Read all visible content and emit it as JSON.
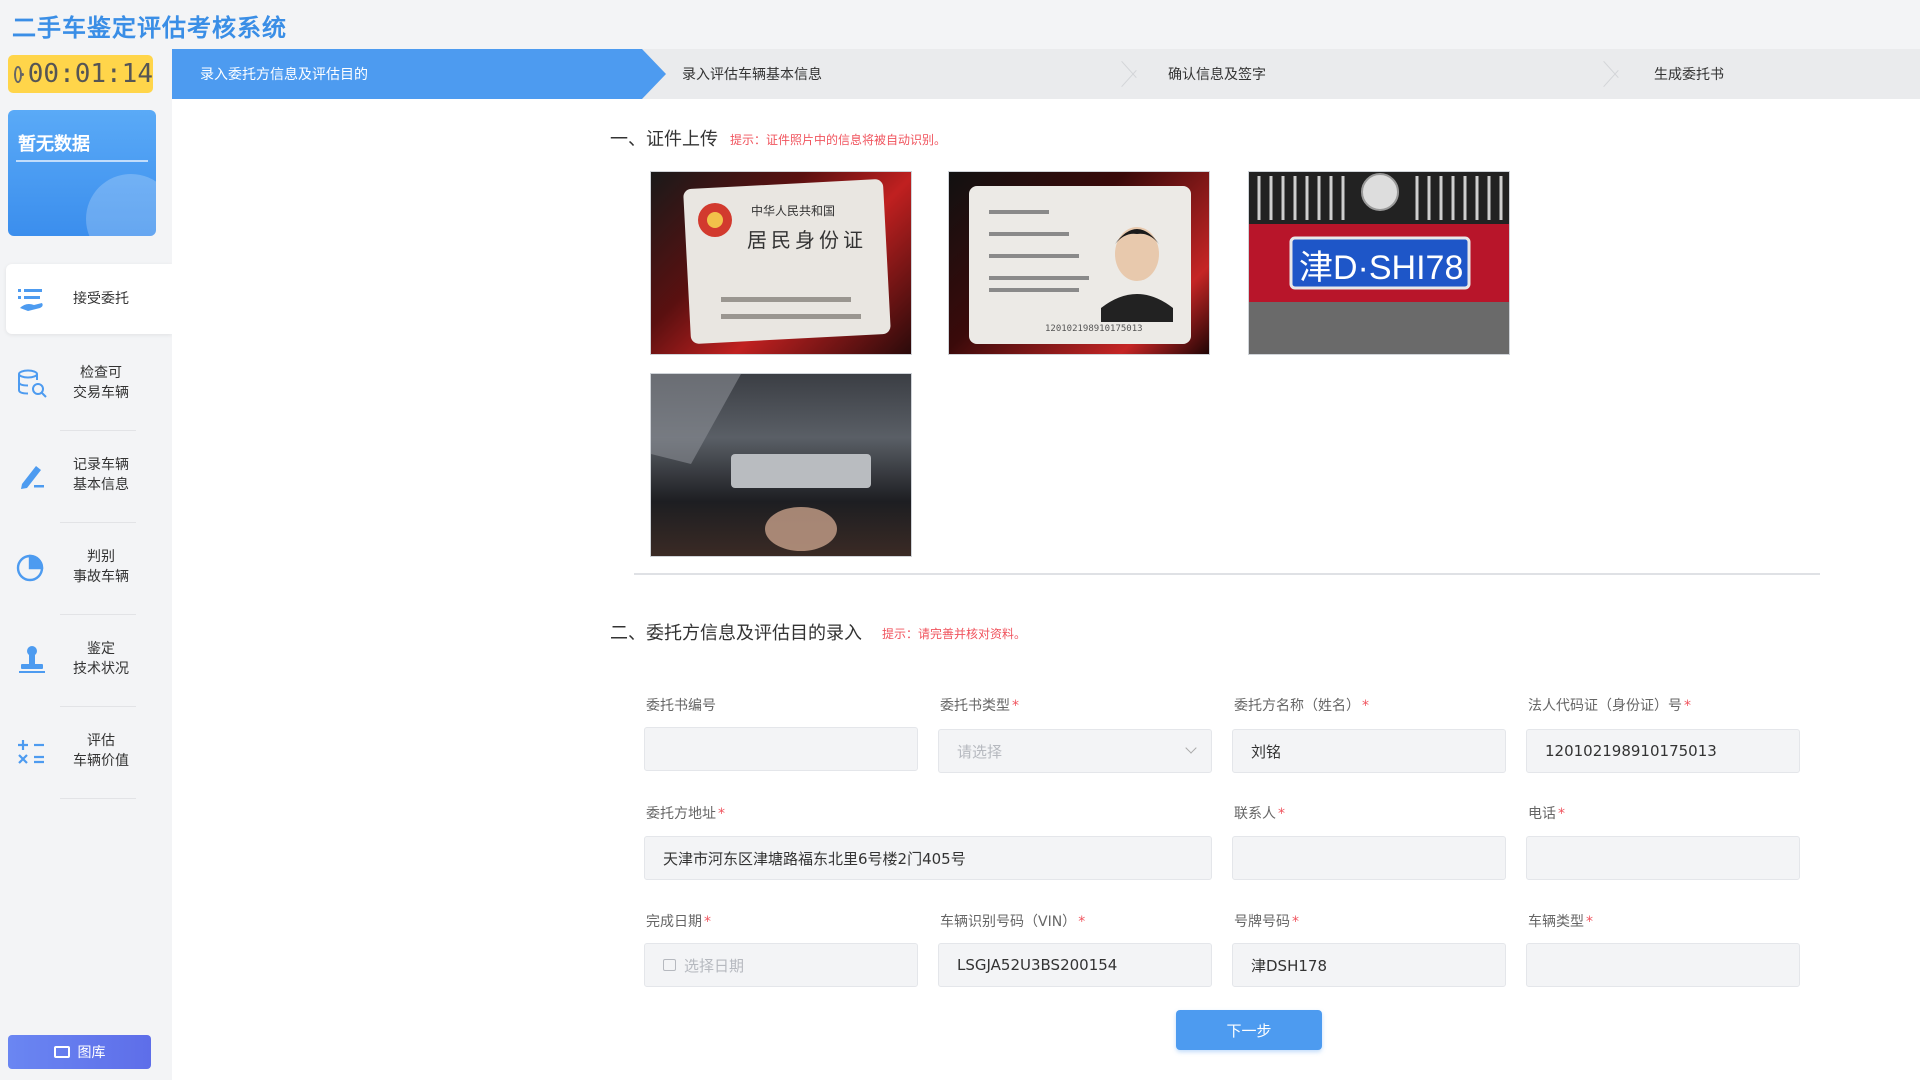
{
  "app": {
    "title": "二手车鉴定评估考核系统"
  },
  "timer": {
    "value": "00:01:14"
  },
  "sidebar": {
    "no_data": "暂无数据",
    "items": [
      {
        "label": "接受委托"
      },
      {
        "label": "检查可\n交易车辆"
      },
      {
        "label": "记录车辆\n基本信息"
      },
      {
        "label": "判别\n事故车辆"
      },
      {
        "label": "鉴定\n技术状况"
      },
      {
        "label": "评估\n车辆价值"
      }
    ],
    "gallery": "图库"
  },
  "steps": [
    {
      "label": "录入委托方信息及评估目的",
      "active": true
    },
    {
      "label": "录入评估车辆基本信息",
      "active": false
    },
    {
      "label": "确认信息及签字",
      "active": false
    },
    {
      "label": "生成委托书",
      "active": false
    }
  ],
  "section1": {
    "title": "一、证件上传",
    "hint": "提示：证件照片中的信息将被自动识别。"
  },
  "uploads": {
    "id_front": {
      "country": "中华人民共和国",
      "title": "居民身份证"
    },
    "id_back": {
      "number": "120102198910175013"
    },
    "plate": {
      "text": "津D·SHI78"
    }
  },
  "section2": {
    "title": "二、委托方信息及评估目的录入",
    "hint": "提示：请完善并核对资料。"
  },
  "form": {
    "commission_no": {
      "label": "委托书编号",
      "required": false,
      "value": ""
    },
    "commission_type": {
      "label": "委托书类型",
      "required": true,
      "placeholder": "请选择"
    },
    "client_name": {
      "label": "委托方名称（姓名）",
      "required": true,
      "value": "刘铭"
    },
    "legal_id": {
      "label": "法人代码证（身份证）号",
      "required": true,
      "value": "120102198910175013"
    },
    "address": {
      "label": "委托方地址",
      "required": true,
      "value": "天津市河东区津塘路福东北里6号楼2门405号"
    },
    "contact": {
      "label": "联系人",
      "required": true,
      "value": ""
    },
    "phone": {
      "label": "电话",
      "required": true,
      "value": ""
    },
    "finish_date": {
      "label": "完成日期",
      "required": true,
      "placeholder": "选择日期"
    },
    "vin": {
      "label": "车辆识别号码（VIN）",
      "required": true,
      "value": "LSGJA52U3BS200154"
    },
    "plate_no": {
      "label": "号牌号码",
      "required": true,
      "value": "津DSH178"
    },
    "vehicle_type": {
      "label": "车辆类型",
      "required": true,
      "value": ""
    }
  },
  "buttons": {
    "next": "下一步"
  },
  "colors": {
    "primary": "#4d9bf0",
    "timer": "#ffd54a",
    "required": "#f0545e",
    "title": "#3a8ee6"
  }
}
